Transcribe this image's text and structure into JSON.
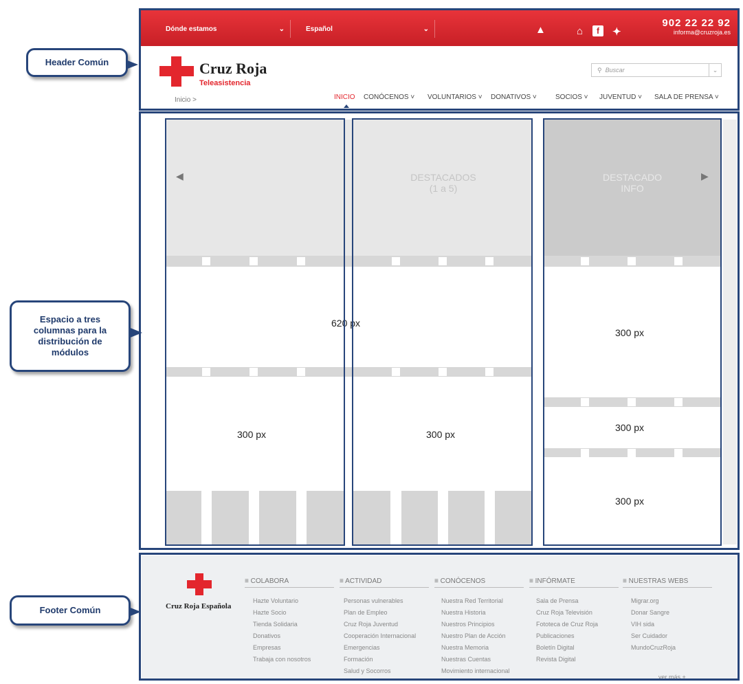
{
  "callouts": {
    "header": "Header Común",
    "content_lines": [
      "Espacio a tres",
      "columnas para la",
      "distribución de",
      "módulos"
    ],
    "footer": "Footer Común"
  },
  "topbar": {
    "location_select": "Dónde estamos",
    "language_select": "Español",
    "phone": "902 22 22 92",
    "email": "informa@cruzroja.es"
  },
  "header": {
    "brand": "Cruz Roja",
    "brand_sub": "Teleasistencia",
    "breadcrumb": "Inicio >",
    "search_placeholder": "Buscar",
    "nav": [
      "INICIO",
      "CONÓCENOS ˅",
      "VOLUNTARIOS ˅",
      "DONATIVOS ˅",
      "SOCIOS ˅",
      "JUVENTUD ˅",
      "SALA DE PRENSA ˅"
    ]
  },
  "content": {
    "featured_title": "DESTACADOS",
    "featured_sub": "(1 a 5)",
    "featured_info_line1": "DESTACADO",
    "featured_info_line2": "INFO",
    "wide_label": "620 px",
    "left_label": "300 px",
    "middle_label": "300 px",
    "right_top_label": "300 px",
    "right_mid_label": "300 px",
    "right_bottom_label": "300 px"
  },
  "footer": {
    "brand": "Cruz Roja Española",
    "more": "ver más +",
    "columns": [
      {
        "title": "COLABORA",
        "items": [
          "Hazte Voluntario",
          "Hazte Socio",
          "Tienda Solidaria",
          "Donativos",
          "Empresas",
          "Trabaja con nosotros"
        ]
      },
      {
        "title": "ACTIVIDAD",
        "items": [
          "Personas vulnerables",
          "Plan de Empleo",
          "Cruz Roja Juventud",
          "Cooperación Internacional",
          "Emergencias",
          "Formación",
          "Salud y Socorros"
        ]
      },
      {
        "title": "CONÓCENOS",
        "items": [
          "Nuestra Red Territorial",
          "Nuestra Historia",
          "Nuestros Principios",
          "Nuestro Plan de Acción",
          "Nuestra Memoria",
          "Nuestras Cuentas",
          "Movimiento internacional"
        ]
      },
      {
        "title": "INFÓRMATE",
        "items": [
          "Sala de Prensa",
          "Cruz Roja Televisión",
          "Fototeca de Cruz Roja",
          "Publicaciones",
          "Boletín Digital",
          "Revista Digital"
        ]
      },
      {
        "title": "NUESTRAS WEBS",
        "items": [
          "Migrar.org",
          "Donar Sangre",
          "VIH sida",
          "Ser Cuidador",
          "MundoCruzRoja"
        ]
      }
    ]
  }
}
